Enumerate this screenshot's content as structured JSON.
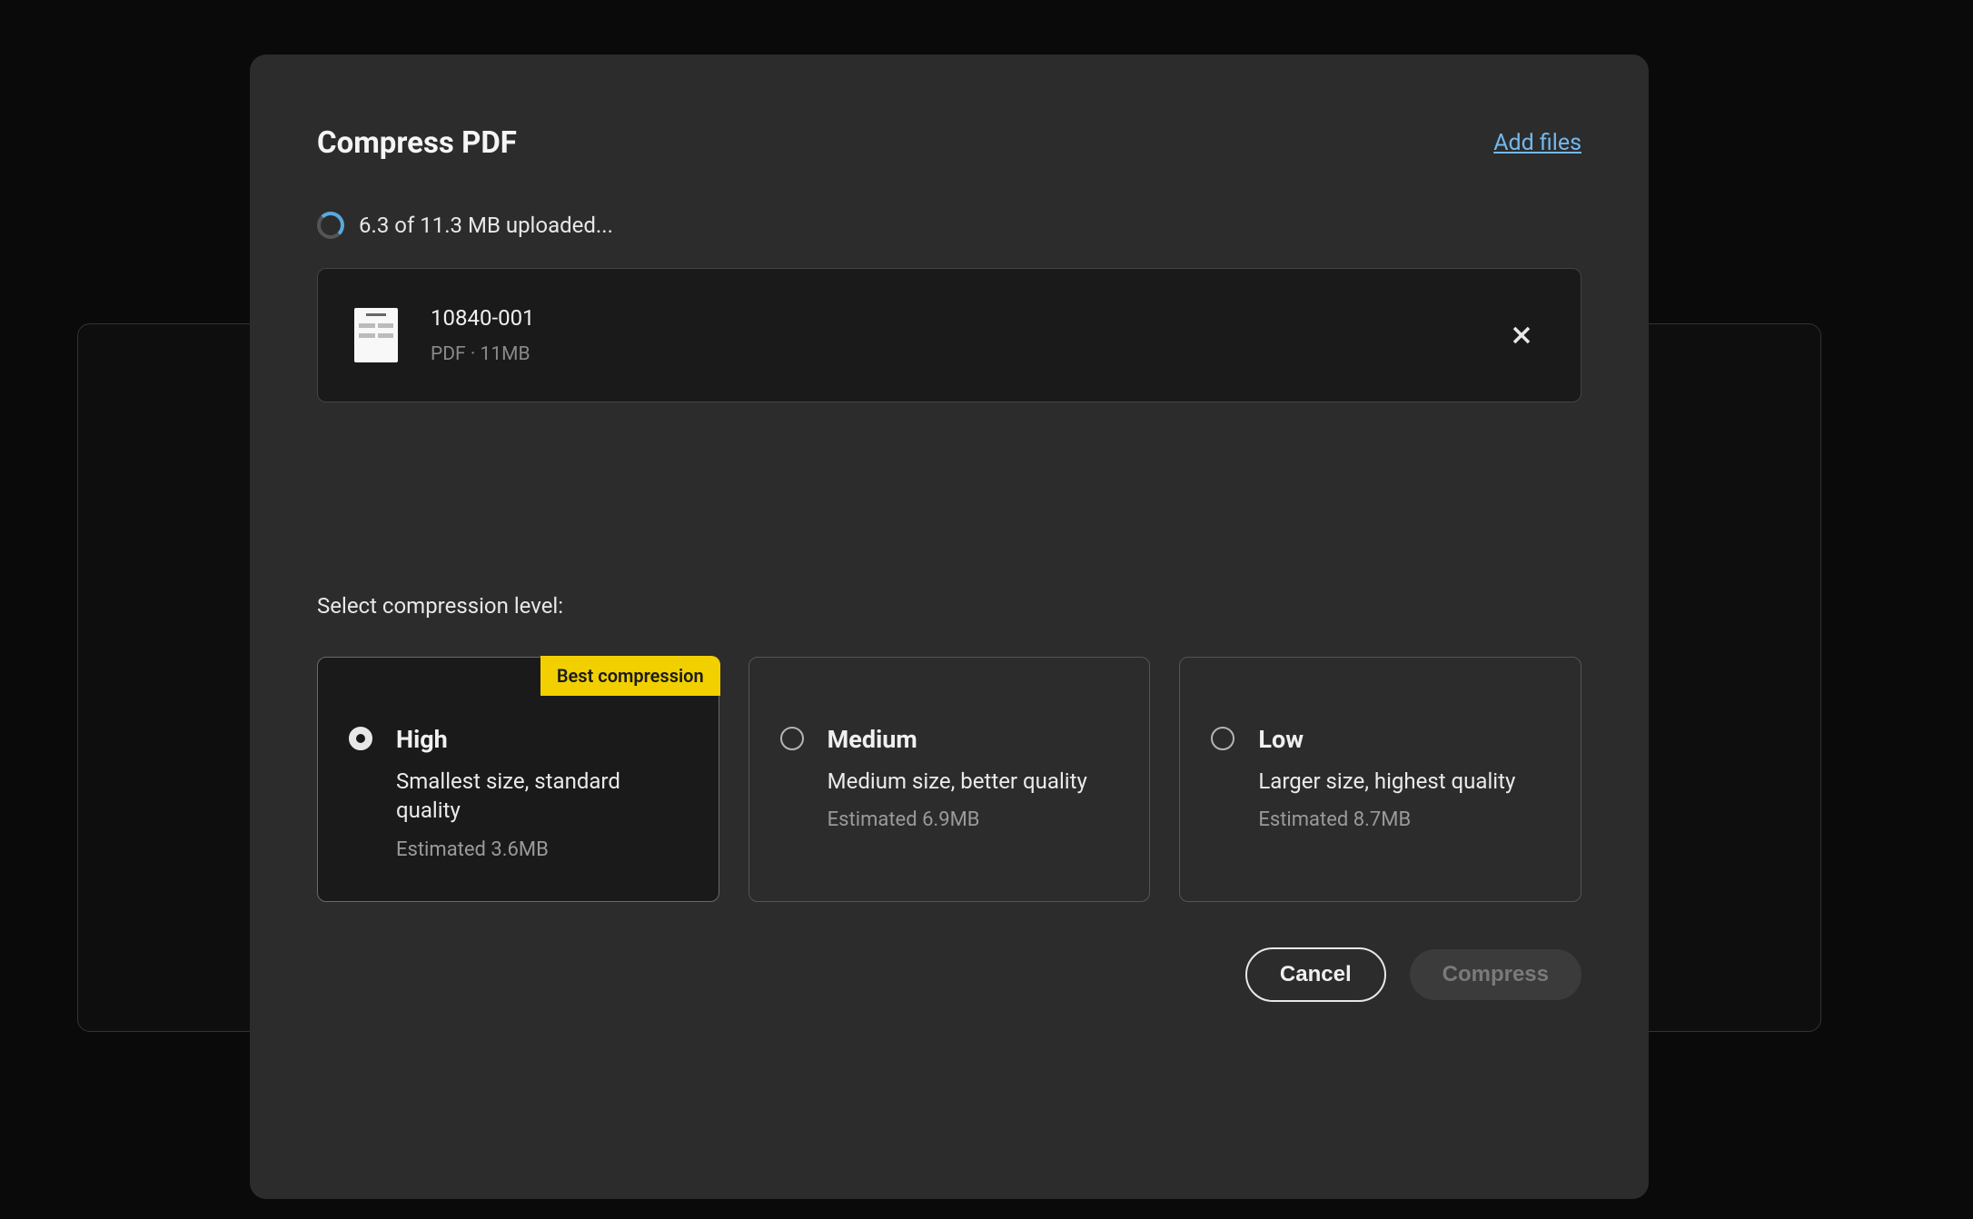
{
  "dialog": {
    "title": "Compress PDF",
    "add_files_label": "Add files"
  },
  "upload": {
    "status_text": "6.3 of 11.3 MB uploaded..."
  },
  "file": {
    "name": "10840-001",
    "meta": "PDF · 11MB"
  },
  "compression": {
    "section_label": "Select compression level:",
    "options": [
      {
        "badge": "Best compression",
        "title": "High",
        "desc": "Smallest size, standard quality",
        "estimate": "Estimated 3.6MB"
      },
      {
        "title": "Medium",
        "desc": "Medium size, better quality",
        "estimate": "Estimated 6.9MB"
      },
      {
        "title": "Low",
        "desc": "Larger size, highest quality",
        "estimate": "Estimated 8.7MB"
      }
    ]
  },
  "actions": {
    "cancel_label": "Cancel",
    "compress_label": "Compress"
  }
}
